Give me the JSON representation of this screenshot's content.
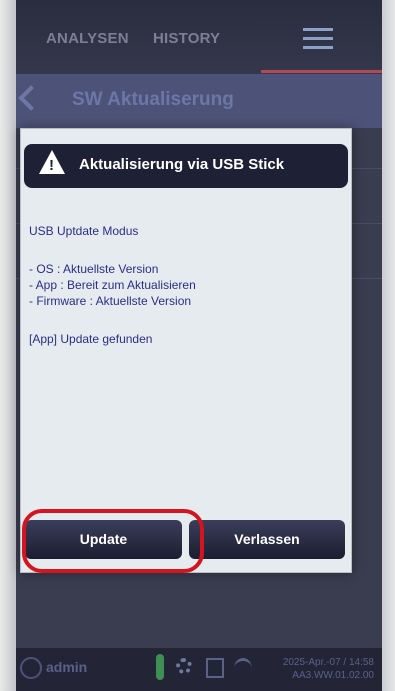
{
  "tabs": {
    "analysen": "ANALYSEN",
    "history": "HISTORY"
  },
  "header": {
    "title": "SW Aktualiserung"
  },
  "dialog": {
    "title": "Aktualisierung via USB Stick",
    "mode_line": "USB Uptdate Modus",
    "items": [
      "- OS : Aktuellste Version",
      "- App : Bereit zum Aktualisieren",
      "- Firmware : Aktuellste Version"
    ],
    "result": "[App] Update gefunden",
    "update_label": "Update",
    "exit_label": "Verlassen"
  },
  "status": {
    "user": "admin",
    "date": "2025-Apr.-07 / 14:58",
    "version": "AA3.WW.01.02.00"
  },
  "colors": {
    "accent": "#b04a55",
    "highlight": "#d4141f",
    "dialog_text": "#2a2f86"
  }
}
